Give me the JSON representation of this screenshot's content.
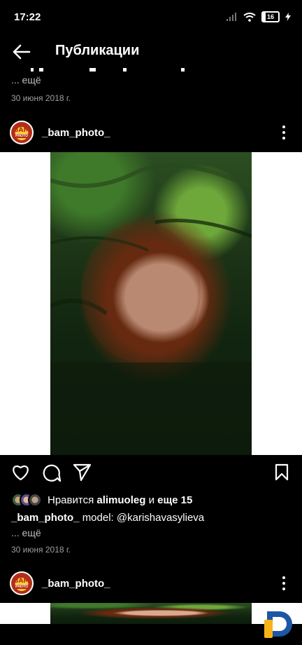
{
  "status": {
    "time": "17:22",
    "battery": "16"
  },
  "header": {
    "title": "Публикации"
  },
  "prev_post": {
    "more": "... ещё",
    "date": "30 июня 2018 г."
  },
  "post": {
    "username": "_bam_photo_",
    "avatar_text_top": "BAM",
    "avatar_text_bottom": "PHOTO",
    "likes_prefix": "Нравится",
    "likes_user": "alimuoleg",
    "likes_and": "и",
    "likes_more": "еще 15",
    "caption_user": "_bam_photo_",
    "caption_text": "model: @karishavasylieva",
    "more": "... ещё",
    "date": "30 июня 2018 г."
  },
  "next_post": {
    "username": "_bam_photo_",
    "avatar_text_top": "BAM",
    "avatar_text_bottom": "PHOTO"
  },
  "colors": {
    "background": "#000000",
    "text": "#ffffff",
    "muted": "#9e9e9e",
    "logo_orange": "#f7b217",
    "logo_blue": "#1c57a5"
  }
}
